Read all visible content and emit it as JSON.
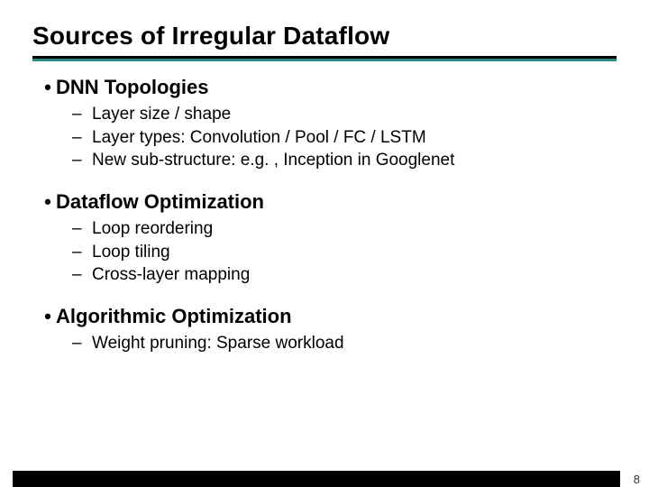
{
  "slide": {
    "title": "Sources of Irregular Dataflow",
    "page_number": "8",
    "sections": [
      {
        "heading": "DNN Topologies",
        "items": [
          "Layer size / shape",
          "Layer types: Convolution / Pool / FC / LSTM",
          "New sub-structure: e.g. , Inception in Googlenet"
        ]
      },
      {
        "heading": "Dataflow Optimization",
        "items": [
          "Loop reordering",
          "Loop tiling",
          "Cross-layer mapping"
        ]
      },
      {
        "heading": "Algorithmic Optimization",
        "items": [
          "Weight pruning: Sparse workload"
        ]
      }
    ]
  }
}
